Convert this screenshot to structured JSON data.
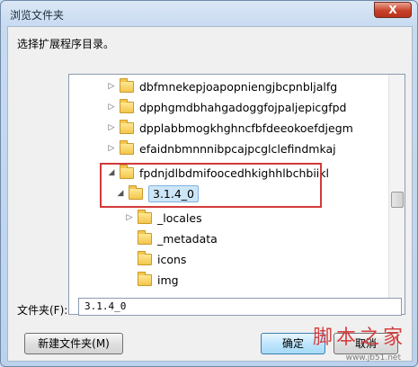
{
  "window": {
    "title": "浏览文件夹",
    "close_label": "X"
  },
  "prompt": "选择扩展程序目录。",
  "tree": {
    "items": [
      {
        "label": "dbfmnekepjoapopniengjbcpnbljalfg",
        "expanded": false,
        "selected": false
      },
      {
        "label": "dpphgmdbhahgadoggfojpaljepicgfpd",
        "expanded": false,
        "selected": false
      },
      {
        "label": "dpplabbmogkhghncfbfdeeokoefdjegm",
        "expanded": false,
        "selected": false
      },
      {
        "label": "efaidnbmnnnibpcajpcglclefindmkaj",
        "expanded": false,
        "selected": false
      },
      {
        "label": "fpdnjdlbdmifoocedhkighhlbchbiikl",
        "expanded": true,
        "selected": false
      },
      {
        "label": "3.1.4_0",
        "expanded": true,
        "selected": true
      },
      {
        "label": "_locales",
        "expanded": false,
        "selected": false
      },
      {
        "label": "_metadata",
        "expanded": false,
        "selected": false
      },
      {
        "label": "icons",
        "expanded": false,
        "selected": false
      },
      {
        "label": "img",
        "expanded": false,
        "selected": false
      }
    ]
  },
  "folder": {
    "label": "文件夹(F):",
    "value": "3.1.4_0"
  },
  "buttons": {
    "new_folder": "新建文件夹(M)",
    "ok": "确定",
    "cancel": "取消"
  },
  "watermark": {
    "text": "脚本之家",
    "url": "www.jb51.net"
  },
  "colors": {
    "selection": "#cde6f7",
    "highlight_box": "#d23a3a",
    "close_button": "#c8432b"
  }
}
